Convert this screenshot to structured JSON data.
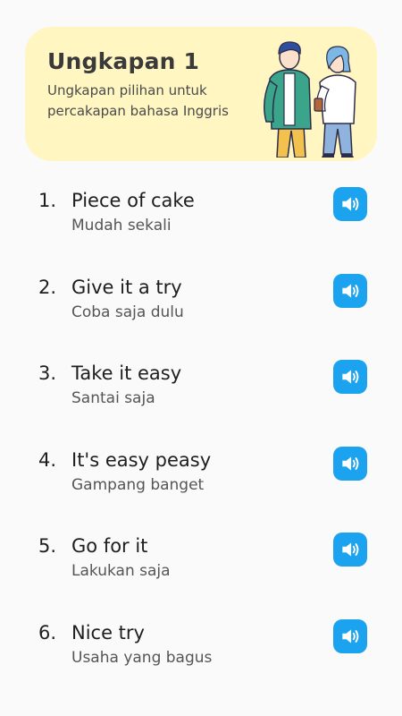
{
  "header": {
    "title": "Ungkapan 1",
    "subtitle": "Ungkapan pilihan untuk percakapan bahasa Inggris",
    "background_color": "#fff6c2",
    "illustration": "couple-talking-illustration"
  },
  "phrases": [
    {
      "number": "1.",
      "phrase": "Piece of cake",
      "translation": "Mudah sekali",
      "icon": "speaker-icon"
    },
    {
      "number": "2.",
      "phrase": "Give it a try",
      "translation": "Coba saja dulu",
      "icon": "speaker-icon"
    },
    {
      "number": "3.",
      "phrase": "Take it easy",
      "translation": "Santai saja",
      "icon": "speaker-icon"
    },
    {
      "number": "4.",
      "phrase": "It's easy peasy",
      "translation": "Gampang banget",
      "icon": "speaker-icon"
    },
    {
      "number": "5.",
      "phrase": "Go for it",
      "translation": "Lakukan saja",
      "icon": "speaker-icon"
    },
    {
      "number": "6.",
      "phrase": "Nice try",
      "translation": "Usaha yang bagus",
      "icon": "speaker-icon"
    }
  ],
  "colors": {
    "accent": "#1ba3f0",
    "background": "#fafafa"
  }
}
